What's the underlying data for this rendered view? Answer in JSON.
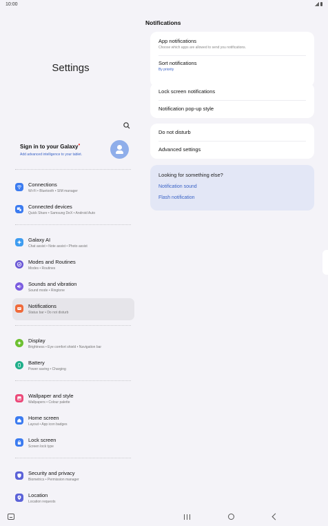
{
  "status_bar": {
    "time": "10:00"
  },
  "left_pane": {
    "title": "Settings",
    "account": {
      "title": "Sign in to your Galaxy",
      "subtitle": "Add advanced intelligence to your tablet."
    },
    "items": [
      {
        "title": "Connections",
        "subtitle": "Wi-Fi  •  Bluetooth  •  SIM manager",
        "icon": "wifi-icon",
        "color": "#3b7bf0"
      },
      {
        "title": "Connected devices",
        "subtitle": "Quick Share  •  Samsung DeX  •  Android Auto",
        "icon": "devices-icon",
        "color": "#3b7bf0"
      },
      {
        "title": "Galaxy AI",
        "subtitle": "Chat assist  •  Note assist  •  Photo assist",
        "icon": "sparkle-icon",
        "color": "#3d9cf0"
      },
      {
        "title": "Modes and Routines",
        "subtitle": "Modes  •  Routines",
        "icon": "check-circle-icon",
        "color": "#6b58d6"
      },
      {
        "title": "Sounds and vibration",
        "subtitle": "Sound mode  •  Ringtone",
        "icon": "speaker-icon",
        "color": "#7b5ce0"
      },
      {
        "title": "Notifications",
        "subtitle": "Status bar  •  Do not disturb",
        "icon": "bell-icon",
        "color": "#f06a3a"
      },
      {
        "title": "Display",
        "subtitle": "Brightness  •  Eye comfort shield  •  Navigation bar",
        "icon": "sun-icon",
        "color": "#6bbf2f"
      },
      {
        "title": "Battery",
        "subtitle": "Power saving  •  Charging",
        "icon": "battery-icon",
        "color": "#1fae8a"
      },
      {
        "title": "Wallpaper and style",
        "subtitle": "Wallpapers  •  Colour palette",
        "icon": "image-icon",
        "color": "#ec4a7a"
      },
      {
        "title": "Home screen",
        "subtitle": "Layout  •  App icon badges",
        "icon": "home-icon",
        "color": "#3b7bf0"
      },
      {
        "title": "Lock screen",
        "subtitle": "Screen lock type",
        "icon": "lock-icon",
        "color": "#3b7bf0"
      },
      {
        "title": "Security and privacy",
        "subtitle": "Biometrics  •  Permission manager",
        "icon": "shield-icon",
        "color": "#5b62d8"
      },
      {
        "title": "Location",
        "subtitle": "Location requests",
        "icon": "location-pin-icon",
        "color": "#5b62d8"
      }
    ]
  },
  "right_pane": {
    "title": "Notifications",
    "card1": {
      "app_notifications": "App notifications",
      "app_notifications_sub": "Choose which apps are allowed to send you notifications.",
      "sort_notifications": "Sort notifications",
      "sort_notifications_sub": "By priority"
    },
    "card2": {
      "lock_screen": "Lock screen notifications",
      "popup_style": "Notification pop-up style"
    },
    "card3": {
      "dnd": "Do not disturb",
      "advanced": "Advanced settings"
    },
    "suggest": {
      "title": "Looking for something else?",
      "link1": "Notification sound",
      "link2": "Flash notification"
    }
  }
}
